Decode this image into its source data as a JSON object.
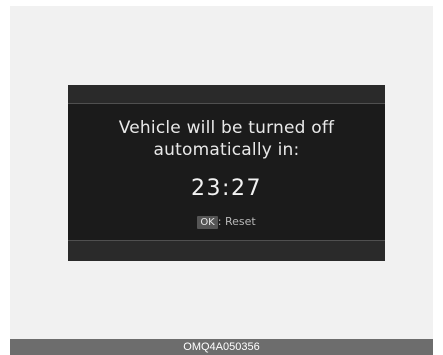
{
  "display": {
    "message_line1": "Vehicle will be turned off",
    "message_line2": "automatically in:",
    "countdown": "23:27",
    "ok_key_label": "OK",
    "reset_label": ": Reset"
  },
  "caption": "OMQ4A050356",
  "colors": {
    "display_background": "#1b1b1b",
    "panel_background": "#f1f1f1",
    "caption_background": "#6d6d6d",
    "text": "#e8e8e8"
  }
}
